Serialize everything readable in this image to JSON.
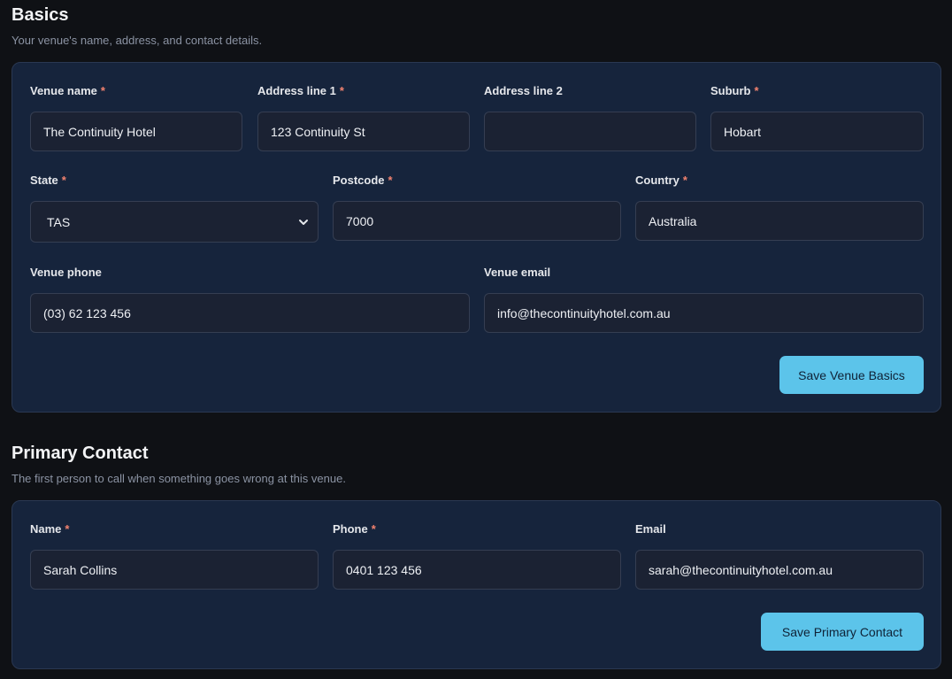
{
  "basics": {
    "title": "Basics",
    "subtitle": "Your venue's name, address, and contact details.",
    "fields": {
      "venue_name": {
        "label": "Venue name",
        "value": "The Continuity Hotel"
      },
      "address1": {
        "label": "Address line 1",
        "value": "123 Continuity St"
      },
      "address2": {
        "label": "Address line 2",
        "value": ""
      },
      "suburb": {
        "label": "Suburb",
        "value": "Hobart"
      },
      "state": {
        "label": "State",
        "value": "TAS"
      },
      "postcode": {
        "label": "Postcode",
        "value": "7000"
      },
      "country": {
        "label": "Country",
        "value": "Australia"
      },
      "phone": {
        "label": "Venue phone",
        "value": "(03) 62 123 456"
      },
      "email": {
        "label": "Venue email",
        "value": "info@thecontinuityhotel.com.au"
      }
    },
    "save_label": "Save Venue Basics"
  },
  "contact": {
    "title": "Primary Contact",
    "subtitle": "The first person to call when something goes wrong at this venue.",
    "fields": {
      "name": {
        "label": "Name",
        "value": "Sarah Collins"
      },
      "phone": {
        "label": "Phone",
        "value": "0401 123 456"
      },
      "email": {
        "label": "Email",
        "value": "sarah@thecontinuityhotel.com.au"
      }
    },
    "save_label": "Save Primary Contact"
  },
  "required_marker": "*",
  "icons": {
    "select": "chevron-down-icon"
  },
  "colors": {
    "accent": "#5cc4ea",
    "required": "#f2826f",
    "card": "#16243c",
    "page": "#0f1115"
  }
}
